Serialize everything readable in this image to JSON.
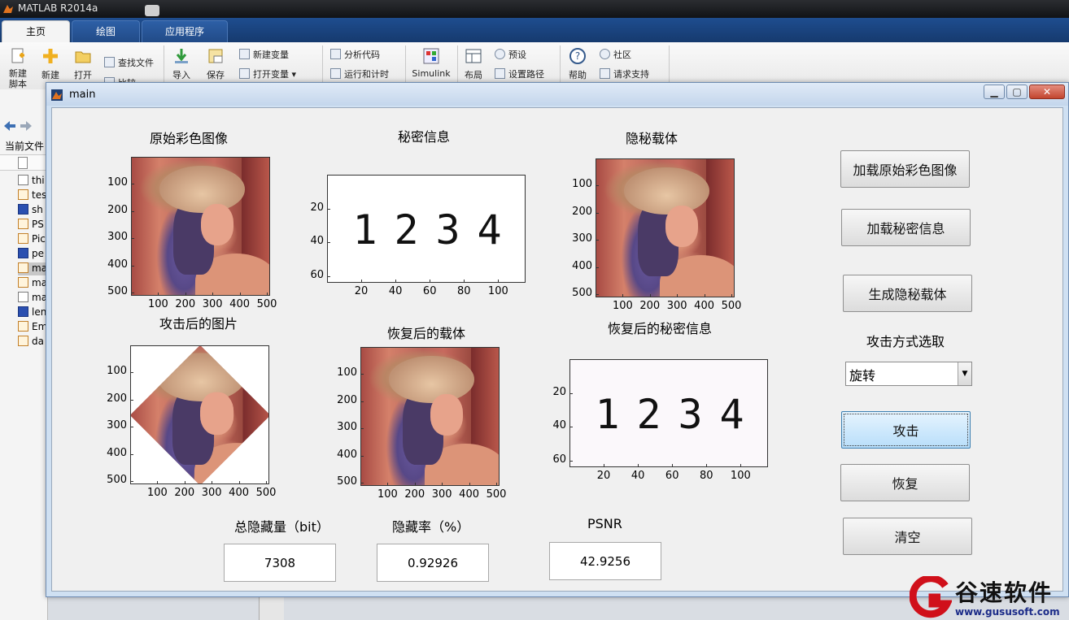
{
  "app": {
    "title": "MATLAB R2014a",
    "tabs": [
      "主页",
      "绘图",
      "应用程序"
    ],
    "ribbon": {
      "new_script": "新建\n脚本",
      "new": "新建",
      "open": "打开",
      "find_files": "查找文件",
      "compare": "比较",
      "import": "导入",
      "save": "保存",
      "new_variable": "新建变量",
      "open_variable": "打开变量",
      "analyze_code": "分析代码",
      "run_and_time": "运行和计时",
      "simulink": "Simulink",
      "layout": "布局",
      "preferences": "预设",
      "set_path": "设置路径",
      "help": "帮助",
      "community": "社区",
      "request_support": "请求支持"
    },
    "current_folder_label": "当前文件",
    "files": [
      {
        "name": "thi",
        "type": "doc"
      },
      {
        "name": "tes",
        "type": "mfile"
      },
      {
        "name": "sh",
        "type": "bmp"
      },
      {
        "name": "PS",
        "type": "mfile"
      },
      {
        "name": "Pic",
        "type": "mfile"
      },
      {
        "name": "pe",
        "type": "bmp"
      },
      {
        "name": "ma",
        "type": "mfile"
      },
      {
        "name": "ma",
        "type": "mfile"
      },
      {
        "name": "ma",
        "type": "doc"
      },
      {
        "name": "len",
        "type": "bmp"
      },
      {
        "name": "Em",
        "type": "mfile"
      },
      {
        "name": "da",
        "type": "mfile"
      }
    ]
  },
  "figure": {
    "title": "main",
    "panels": {
      "original": {
        "title": "原始彩色图像",
        "xticks": [
          "100",
          "200",
          "300",
          "400",
          "500"
        ],
        "yticks": [
          "100",
          "200",
          "300",
          "400",
          "500"
        ]
      },
      "secret": {
        "title": "秘密信息",
        "digits": [
          "1",
          "2",
          "3",
          "4"
        ],
        "xticks": [
          "20",
          "40",
          "60",
          "80",
          "100"
        ],
        "yticks": [
          "20",
          "40",
          "60"
        ]
      },
      "stego": {
        "title": "隐秘载体",
        "xticks": [
          "100",
          "200",
          "300",
          "400",
          "500"
        ],
        "yticks": [
          "100",
          "200",
          "300",
          "400",
          "500"
        ]
      },
      "attacked": {
        "title": "攻击后的图片",
        "xticks": [
          "100",
          "200",
          "300",
          "400",
          "500"
        ],
        "yticks": [
          "100",
          "200",
          "300",
          "400",
          "500"
        ]
      },
      "recovered": {
        "title": "恢复后的载体",
        "xticks": [
          "100",
          "200",
          "300",
          "400",
          "500"
        ],
        "yticks": [
          "100",
          "200",
          "300",
          "400",
          "500"
        ]
      },
      "recovered_secret": {
        "title": "恢复后的秘密信息",
        "digits": [
          "1",
          "2",
          "3",
          "4"
        ],
        "xticks": [
          "20",
          "40",
          "60",
          "80",
          "100"
        ],
        "yticks": [
          "20",
          "40",
          "60"
        ]
      }
    },
    "buttons": {
      "load_original": "加载原始彩色图像",
      "load_secret": "加载秘密信息",
      "generate": "生成隐秘载体",
      "attack_method_label": "攻击方式选取",
      "attack_method_value": "旋转",
      "attack": "攻击",
      "recover": "恢复",
      "clear": "清空"
    },
    "outputs": {
      "capacity_label": "总隐藏量（bit）",
      "capacity_value": "7308",
      "rate_label": "隐藏率（%）",
      "rate_value": "0.92926",
      "psnr_label": "PSNR",
      "psnr_value": "42.9256"
    }
  },
  "watermark": {
    "text": "谷速软件",
    "url": "www.gususoft.com",
    "color": "#d0101a"
  }
}
